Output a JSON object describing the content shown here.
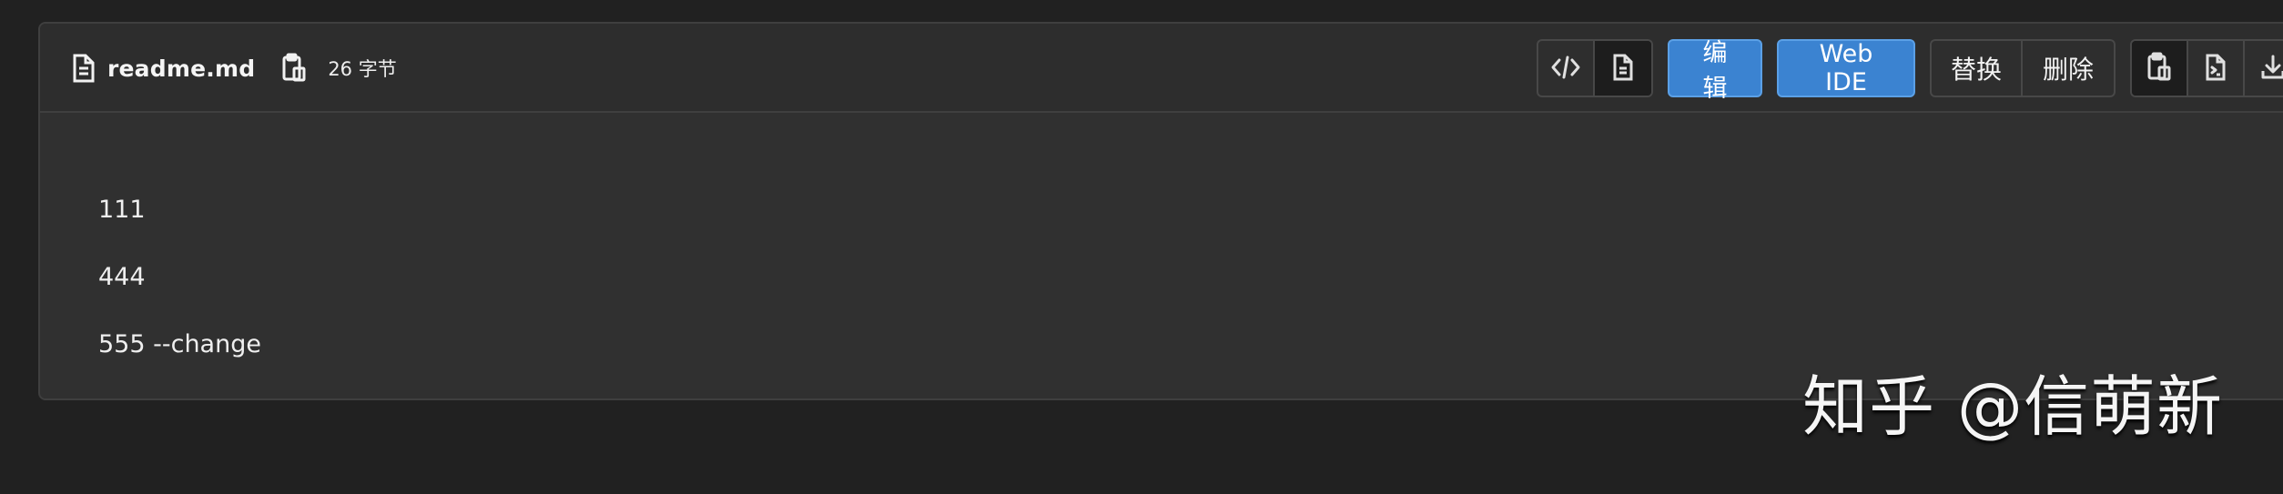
{
  "file": {
    "name": "readme.md",
    "size": "26 字节",
    "icons": {
      "file": "document-icon",
      "copy_path": "clipboard-icon"
    }
  },
  "toolbar": {
    "view_source_icon": "code-icon",
    "rendered_view_icon": "document-icon",
    "edit_label": "编辑",
    "web_ide_label": "Web IDE",
    "replace_label": "替换",
    "delete_label": "删除",
    "copy_icon": "clipboard-icon",
    "raw_icon": "terminal-file-icon",
    "download_icon": "download-icon"
  },
  "content": {
    "lines": [
      "111",
      "444",
      "555 --change"
    ]
  },
  "watermark": {
    "text": "知乎 @信萌新"
  },
  "colors": {
    "page_background": "#212121",
    "card_background": "#303030",
    "primary_button": "#3b83d1",
    "border": "#3f3f3f"
  }
}
